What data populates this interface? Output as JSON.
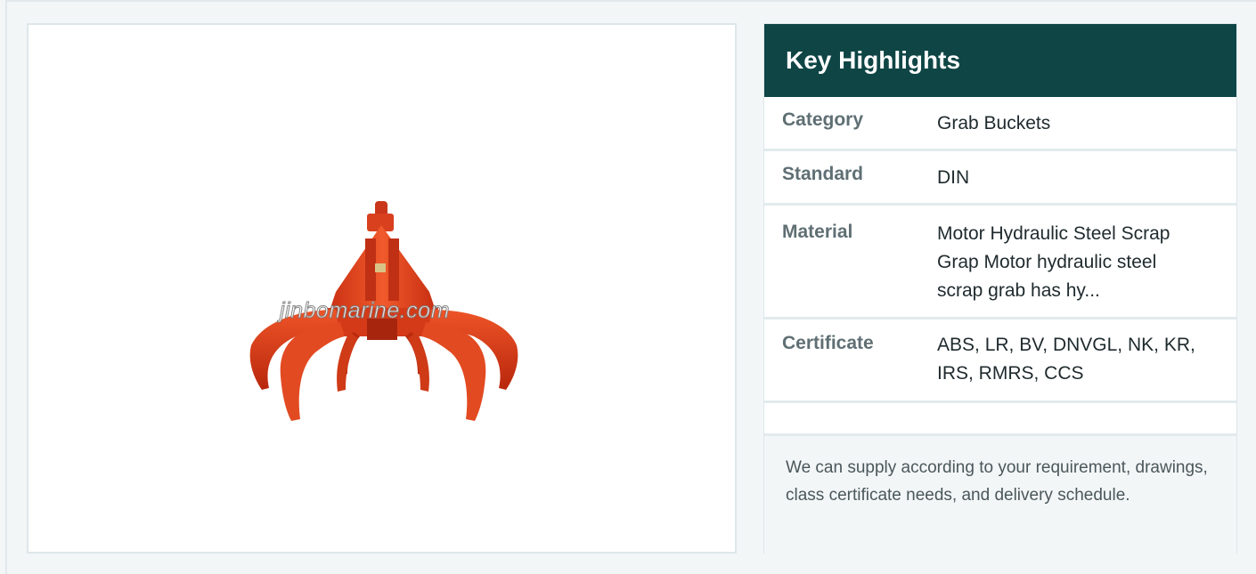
{
  "product_image": {
    "alt": "Motor Hydraulic Steel Scrap Grab",
    "watermark": "jinbomarine.com"
  },
  "highlights": {
    "title": "Key Highlights",
    "rows": [
      {
        "key": "Category",
        "value": "Grab Buckets"
      },
      {
        "key": "Standard",
        "value": "DIN"
      },
      {
        "key": "Material",
        "value": "Motor Hydraulic Steel Scrap Grap Motor hydraulic steel scrap grab has hy..."
      },
      {
        "key": "Certificate",
        "value": "ABS, LR, BV, DNVGL, NK, KR, IRS, RMRS, CCS"
      }
    ],
    "footer": "We can supply according to your requirement, drawings, class certificate needs, and delivery schedule."
  },
  "colors": {
    "header_bg": "#0f4545",
    "grab_orange": "#e8401f"
  }
}
